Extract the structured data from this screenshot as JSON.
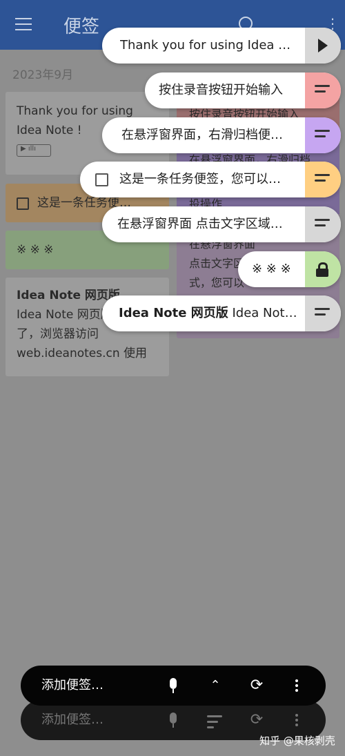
{
  "app": {
    "title": "便签"
  },
  "date_header": "2023年9月",
  "notes_left": [
    {
      "text": "Thank you for using Idea Note !"
    },
    {
      "text": "这是一条任务便…"
    },
    {
      "text": "※ ※ ※"
    },
    {
      "title": "Idea Note 网页版",
      "body": "Idea Note 网页版上线了，浏览器访问 web.ideanotes.cn 使用"
    }
  ],
  "notes_right": [
    "按住录音按钮开始输入",
    "在悬浮窗界面，右滑归档",
    "投操作",
    "在悬浮窗界面",
    "点击文字区",
    "式，您可以"
  ],
  "bubbles": [
    {
      "text": "Thank you for using Idea N…",
      "side_color": "#d7d7d7",
      "icon": "play-icon"
    },
    {
      "text": "按住录音按钮开始输入",
      "side_color": "#f4a3a3",
      "icon": "lines-icon"
    },
    {
      "text": "在悬浮窗界面，右滑归档便…",
      "side_color": "#c6a6f1",
      "icon": "lines-icon"
    },
    {
      "text": "这是一条任务便签，您可以…",
      "side_color": "#ffcf82",
      "icon": "lines-icon",
      "checkbox": true
    },
    {
      "text": "在悬浮窗界面 点击文字区域…",
      "side_color": "#d7d7d7",
      "icon": "lines-icon"
    },
    {
      "text": "※ ※ ※",
      "side_color": "#bfe3a4",
      "icon": "lock-icon"
    },
    {
      "title": "Idea Note 网页版",
      "text": "Idea Note…",
      "side_color": "#d7d7d7",
      "icon": "lines-icon"
    }
  ],
  "bottom_bar": {
    "placeholder": "添加便签…"
  },
  "watermark": "知乎 @果核剥壳"
}
